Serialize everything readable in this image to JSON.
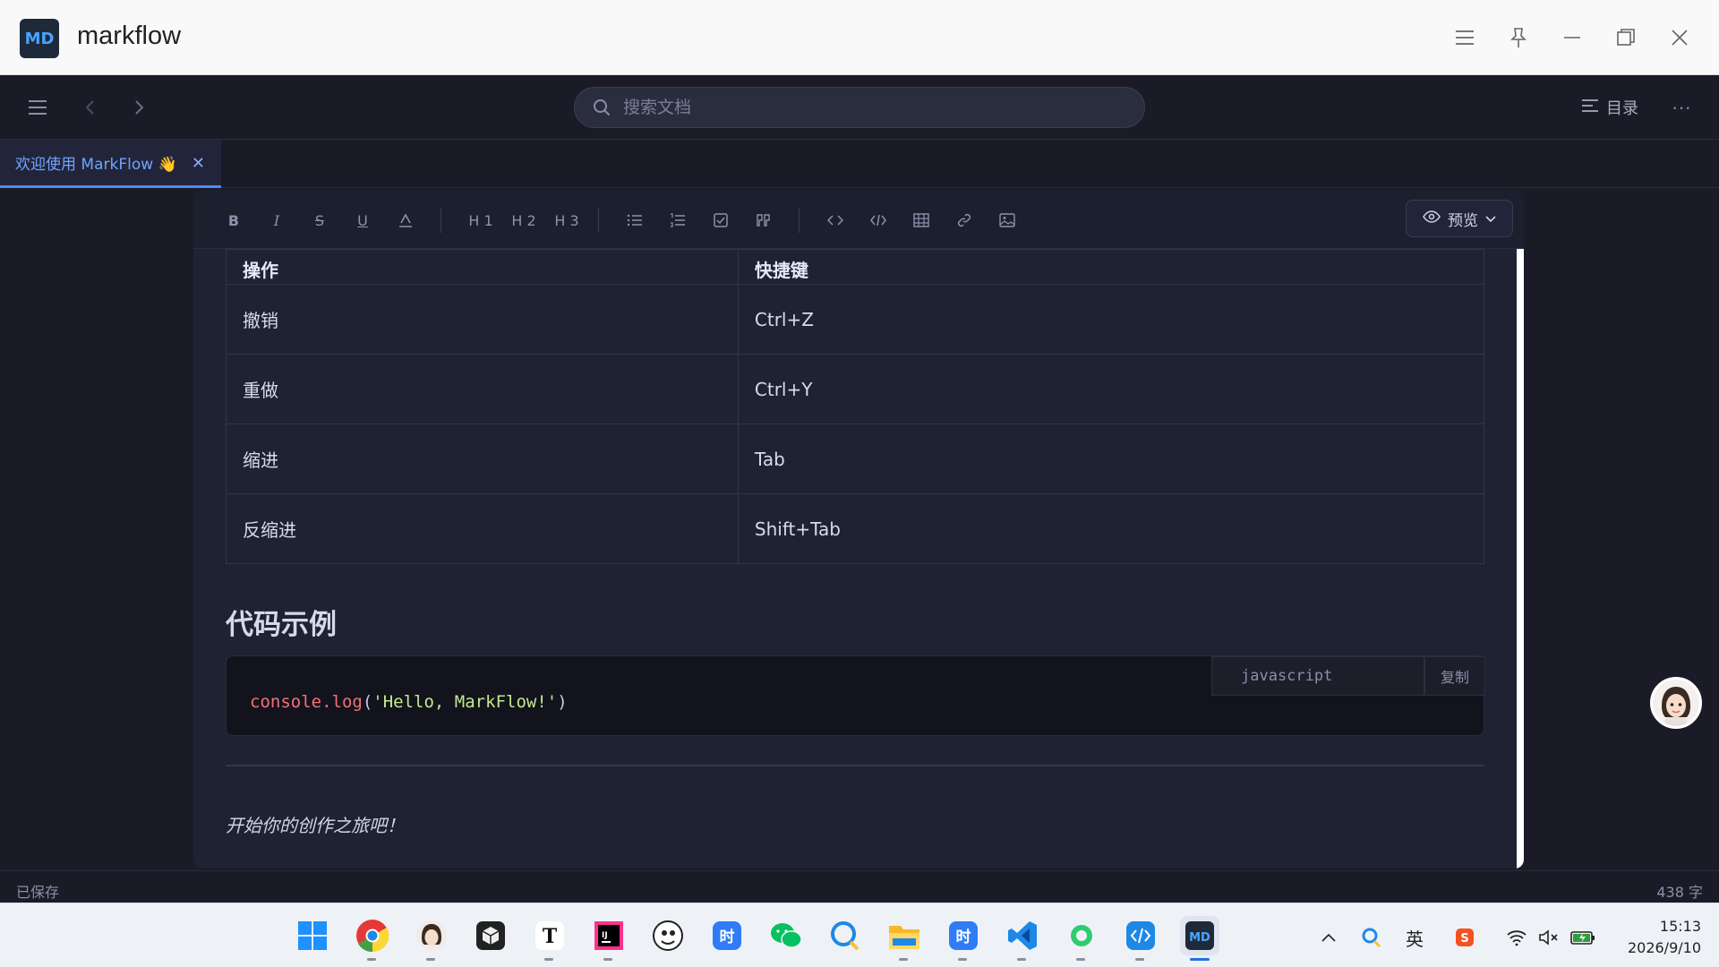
{
  "window": {
    "app_title": "markflow",
    "logo_text": "MD",
    "controls": [
      "menu-icon",
      "pin-icon",
      "minimize-icon",
      "restore-icon",
      "close-icon"
    ]
  },
  "header": {
    "search_placeholder": "搜索文档",
    "toc_label": "目录",
    "more_label": "···"
  },
  "tabs": [
    {
      "label": "欢迎使用 MarkFlow 👋",
      "active": true
    }
  ],
  "format_toolbar": {
    "h1": "H 1",
    "h2": "H 2",
    "h3": "H 3",
    "preview_label": "预览"
  },
  "document": {
    "table": {
      "headers": [
        "操作",
        "快捷键"
      ],
      "rows": [
        [
          "撤销",
          "Ctrl+Z"
        ],
        [
          "重做",
          "Ctrl+Y"
        ],
        [
          "缩进",
          "Tab"
        ],
        [
          "反缩进",
          "Shift+Tab"
        ]
      ]
    },
    "heading": "代码示例",
    "code": {
      "language": "javascript",
      "copy_label": "复制",
      "fn": "console.log",
      "open": "(",
      "string": "'Hello, MarkFlow!'",
      "close": ")"
    },
    "closing_line": "开始你的创作之旅吧！"
  },
  "status": {
    "saved": "已保存",
    "word_count": "438 字"
  },
  "taskbar": {
    "apps": [
      "windows-start",
      "chrome",
      "avatar-app",
      "cube-app",
      "typora",
      "jetbrains-ij",
      "photo-app",
      "time-app",
      "wechat",
      "chat-app",
      "file-explorer",
      "time-app-2",
      "vscode",
      "green-app",
      "code-app",
      "markflow"
    ],
    "input_method": "英",
    "time": "15:13",
    "date": "2026/9/10"
  },
  "colors": {
    "accent": "#4a8cff",
    "background": "#1a1b26",
    "editor_bg": "#1f2233"
  }
}
